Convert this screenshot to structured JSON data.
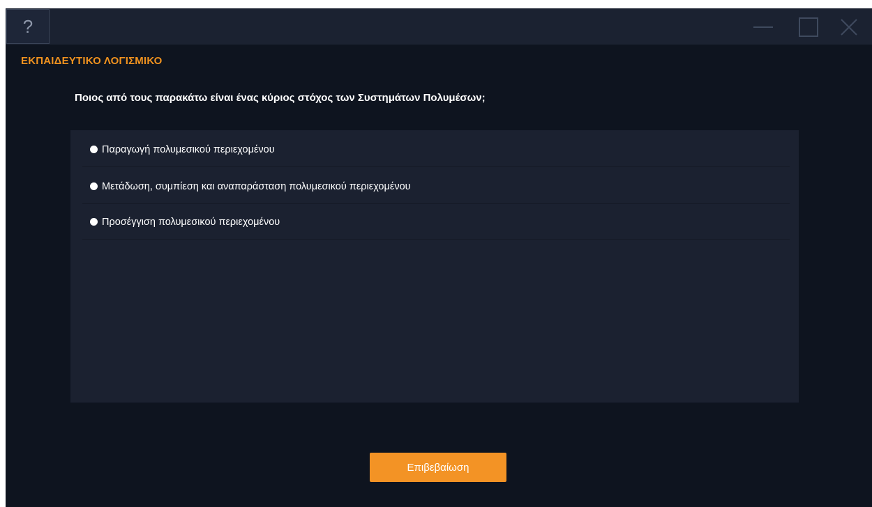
{
  "titlebar": {
    "help_label": "?",
    "controls": [
      "minimize-icon",
      "maximize-icon",
      "close-icon"
    ]
  },
  "app": {
    "title": "ΕΚΠΑΙΔΕΥΤΙΚΟ ΛΟΓΙΣΜΙΚΟ"
  },
  "quiz": {
    "question": "Ποιος από τους παρακάτω είναι ένας κύριος στόχος των Συστημάτων Πολυμέσων;",
    "options": [
      {
        "label": "Παραγωγή πολυμεσικού περιεχομένου",
        "selected": false
      },
      {
        "label": "Μετάδωση, συμπίεση και αναπαράσταση πολυμεσικού περιεχομένου",
        "selected": false
      },
      {
        "label": "Προσέγγιση πολυμεσικού περιεχομένου",
        "selected": false
      }
    ],
    "confirm_label": "Επιβεβαίωση"
  },
  "colors": {
    "accent": "#f39325",
    "title_accent": "#f0921f",
    "window_bg": "#0e141f",
    "panel_bg": "#1b2130",
    "titlebar_bg": "#1b2231"
  }
}
